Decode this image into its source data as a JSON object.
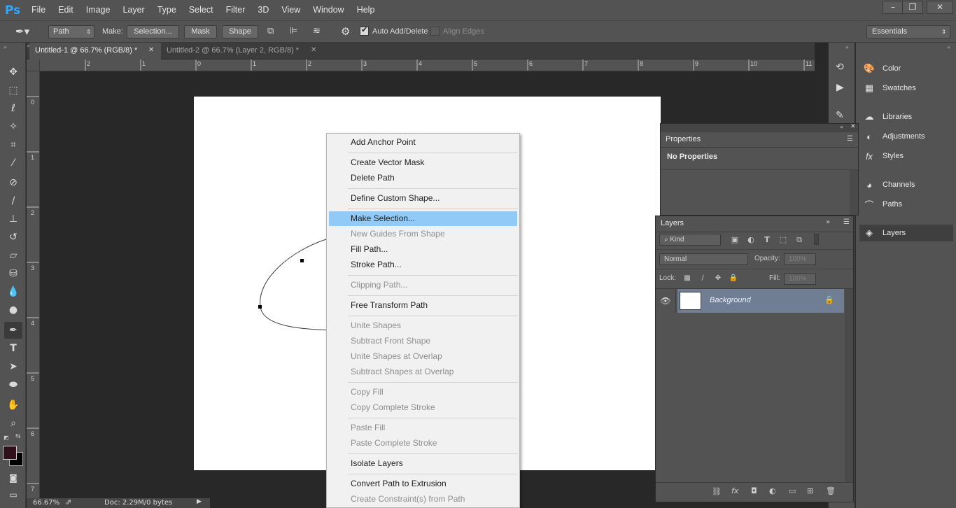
{
  "app": {
    "logo": "Ps"
  },
  "menu": [
    "File",
    "Edit",
    "Image",
    "Layer",
    "Type",
    "Select",
    "Filter",
    "3D",
    "View",
    "Window",
    "Help"
  ],
  "window_controls": {
    "minimize": "–",
    "restore": "❐",
    "close": "✕"
  },
  "options": {
    "tool_mode": "Path",
    "make_label": "Make:",
    "selection_btn": "Selection...",
    "mask_btn": "Mask",
    "shape_btn": "Shape",
    "auto_add_delete": "Auto Add/Delete",
    "auto_add_delete_checked": true,
    "align_edges": "Align Edges",
    "align_edges_checked": false,
    "workspace": "Essentials"
  },
  "tabs": [
    {
      "label": "Untitled-1 @ 66.7% (RGB/8) *",
      "active": true
    },
    {
      "label": "Untitled-2 @ 66.7% (Layer 2, RGB/8) *",
      "active": false
    }
  ],
  "ruler_h": [
    "2",
    "1",
    "0",
    "1",
    "2",
    "3",
    "4",
    "5",
    "6",
    "7",
    "8",
    "9",
    "10",
    "11"
  ],
  "ruler_v": [
    "0",
    "1",
    "2",
    "3",
    "4",
    "5",
    "6",
    "7"
  ],
  "status": {
    "zoom": "66.67%",
    "doc": "Doc: 2.29M/0 bytes"
  },
  "context_menu": [
    {
      "label": "Add Anchor Point",
      "disabled": false
    },
    {
      "label": "Create Vector Mask",
      "disabled": false
    },
    {
      "label": "Delete Path",
      "disabled": false
    },
    {
      "label": "Define Custom Shape...",
      "disabled": false
    },
    {
      "label": "Make Selection...",
      "disabled": false,
      "highlighted": true
    },
    {
      "label": "New Guides From Shape",
      "disabled": true
    },
    {
      "label": "Fill Path...",
      "disabled": false
    },
    {
      "label": "Stroke Path...",
      "disabled": false
    },
    {
      "label": "Clipping Path...",
      "disabled": true
    },
    {
      "label": "Free Transform Path",
      "disabled": false
    },
    {
      "label": "Unite Shapes",
      "disabled": true
    },
    {
      "label": "Subtract Front Shape",
      "disabled": true
    },
    {
      "label": "Unite Shapes at Overlap",
      "disabled": true
    },
    {
      "label": "Subtract Shapes at Overlap",
      "disabled": true
    },
    {
      "label": "Copy Fill",
      "disabled": true
    },
    {
      "label": "Copy Complete Stroke",
      "disabled": true
    },
    {
      "label": "Paste Fill",
      "disabled": true
    },
    {
      "label": "Paste Complete Stroke",
      "disabled": true
    },
    {
      "label": "Isolate Layers",
      "disabled": false
    },
    {
      "label": "Convert Path to Extrusion",
      "disabled": false
    },
    {
      "label": "Create Constraint(s) from Path",
      "disabled": true
    }
  ],
  "right_panels": [
    "Color",
    "Swatches",
    "Libraries",
    "Adjustments",
    "Styles",
    "Channels",
    "Paths",
    "Layers"
  ],
  "properties": {
    "title": "Properties",
    "content": "No Properties"
  },
  "layers": {
    "title": "Layers",
    "filter_kind": "Kind",
    "blend_mode": "Normal",
    "opacity_label": "Opacity:",
    "opacity_value": "100%",
    "lock_label": "Lock:",
    "fill_label": "Fill:",
    "fill_value": "100%",
    "items": [
      {
        "name": "Background",
        "visible": true,
        "locked": true
      }
    ]
  },
  "colors": {
    "accent": "#31a8ff",
    "highlight": "#91c9f7",
    "selected_layer": "#6f7e92",
    "foreground": "#2e0f1a",
    "background": "#000000"
  }
}
